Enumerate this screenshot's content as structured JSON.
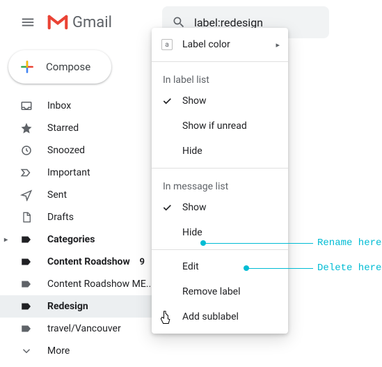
{
  "header": {
    "product_name": "Gmail",
    "search_value": "label:redesign"
  },
  "compose_label": "Compose",
  "sidebar": {
    "items": [
      {
        "label": "Inbox"
      },
      {
        "label": "Starred"
      },
      {
        "label": "Snoozed"
      },
      {
        "label": "Important"
      },
      {
        "label": "Sent"
      },
      {
        "label": "Drafts"
      },
      {
        "label": "Categories"
      },
      {
        "label": "Content Roadshow",
        "count": "9"
      },
      {
        "label": "Content Roadshow ME..."
      },
      {
        "label": "Redesign"
      },
      {
        "label": "travel/Vancouver"
      },
      {
        "label": "More"
      }
    ]
  },
  "menu": {
    "label_color": "Label color",
    "swatch_letter": "a",
    "section_label_list": "In label list",
    "show": "Show",
    "show_if_unread": "Show if unread",
    "hide": "Hide",
    "section_message_list": "In message list",
    "edit": "Edit",
    "remove": "Remove label",
    "add_sublabel": "Add sublabel"
  },
  "annotations": {
    "rename": "Rename here",
    "delete": "Delete here"
  }
}
